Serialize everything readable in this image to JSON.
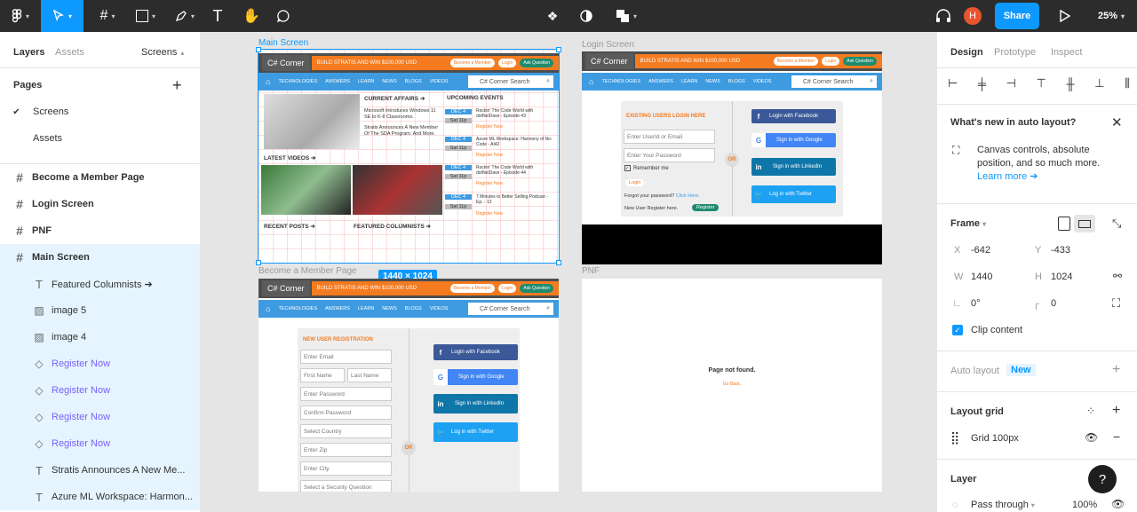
{
  "toolbar": {
    "share": "Share",
    "zoom": "25%",
    "avatar": "H"
  },
  "left": {
    "tabs": {
      "layers": "Layers",
      "assets": "Assets",
      "screens": "Screens"
    },
    "pages_title": "Pages",
    "pages": [
      "Screens",
      "Assets"
    ],
    "layers": [
      {
        "label": "Become a Member Page"
      },
      {
        "label": "Login Screen"
      },
      {
        "label": "PNF"
      },
      {
        "label": "Main Screen"
      },
      {
        "label": "Featured Columnists ➔"
      },
      {
        "label": "image 5"
      },
      {
        "label": "image 4"
      },
      {
        "label": "Register Now"
      },
      {
        "label": "Register Now"
      },
      {
        "label": "Register Now"
      },
      {
        "label": "Register Now"
      },
      {
        "label": "Stratis Announces A New Me..."
      },
      {
        "label": "Azure ML Workspace: Harmon..."
      }
    ]
  },
  "right": {
    "tabs": {
      "design": "Design",
      "prototype": "Prototype",
      "inspect": "Inspect"
    },
    "whats_new": {
      "title": "What's new in auto layout?",
      "body": "Canvas controls, absolute position, and so much more.",
      "link": "Learn more ➔"
    },
    "frame": {
      "title": "Frame",
      "x_label": "X",
      "x": "-642",
      "y_label": "Y",
      "y": "-433",
      "w_label": "W",
      "w": "1440",
      "h_label": "H",
      "h": "1024",
      "rotation": "0°",
      "radius": "0",
      "clip": "Clip content"
    },
    "auto_layout": {
      "title": "Auto layout",
      "badge": "New"
    },
    "layout_grid": {
      "title": "Layout grid",
      "item": "Grid 100px"
    },
    "layer": {
      "title": "Layer",
      "blend": "Pass through",
      "opacity": "100%"
    },
    "help": "?"
  },
  "canvas": {
    "main": {
      "label": "Main Screen",
      "size": "1440 × 1024",
      "sections": {
        "current": "CURRENT AFFAIRS ➔",
        "upcoming": "UPCOMING EVENTS",
        "latest": "LATEST VIDEOS ➔",
        "recent": "RECENT POSTS ➔",
        "featured": "FEATURED COLUMNISTS ➔"
      },
      "news": [
        "Microsoft Introduces Windows 11 SE to K-8 Classrooms.",
        "Stratis Announces A New Member Of The SDA Program. And More."
      ],
      "events": [
        {
          "date": "DEC 4",
          "day": "Sat 11p",
          "title": "Rockin' The Code World with dotNetDave - Episode 43",
          "cta": "Register Now"
        },
        {
          "date": "DEC 4",
          "day": "Sat 11p",
          "title": "Azure ML Workspace: Harmony of No-Code - AI42",
          "cta": "Register Now"
        },
        {
          "date": "DEC 4",
          "day": "Sat 11p",
          "title": "Rockin' The Code World with dotNetDave - Episode 44",
          "cta": "Register Now"
        },
        {
          "date": "DEC 4",
          "day": "Sat 11p",
          "title": "7 Minutes to Better Selling Podcast - Ep. - 12",
          "cta": "Register Now"
        }
      ]
    },
    "login": {
      "label": "Login Screen",
      "title": "EXISTING USERS LOGIN HERE",
      "userid": "Enter UserId or Email",
      "password": "Enter Your Password",
      "remember": "Remember me",
      "login_btn": "Login",
      "forgot": "Forgot your password?",
      "click": "Click Here.",
      "newuser": "New User Register here.",
      "register": "Register",
      "or": "OR"
    },
    "member": {
      "label": "Become a Member Page",
      "title": "NEW USER REGISTRATION",
      "fields": [
        "Enter Email",
        "First Name",
        "Last Name",
        "Enter Password",
        "Confirm Password",
        "Select Country",
        "Enter Zip",
        "Enter City",
        "Select a Security Question"
      ],
      "or": "OR"
    },
    "pnf": {
      "label": "PNF",
      "title": "Page not found.",
      "back": "Go Back."
    },
    "site": {
      "logo": "C# Corner",
      "promo": "BUILD STRATIS AND WIN $100,000 USD",
      "member_btn": "Become a Member",
      "login_btn": "Login",
      "ask_btn": "Ask Question",
      "nav": [
        "TECHNOLOGIES",
        "ANSWERS",
        "LEARN",
        "NEWS",
        "BLOGS",
        "VIDEOS"
      ],
      "search": "C# Corner Search"
    },
    "social": {
      "facebook": "Login with Facebook",
      "google": "Sign in with Google",
      "linkedin": "Sign in with LinkedIn",
      "twitter": "Log in with Twitter"
    },
    "social_signup": {
      "facebook": "Login with Facebook",
      "google": "Sign in with Google",
      "linkedin": "Sign in with LinkedIn",
      "twitter": "Log in with Twitter"
    }
  },
  "colors": {
    "accent": "#0d99ff",
    "brand_orange": "#f47b20",
    "nav_blue": "#3e9be0"
  }
}
